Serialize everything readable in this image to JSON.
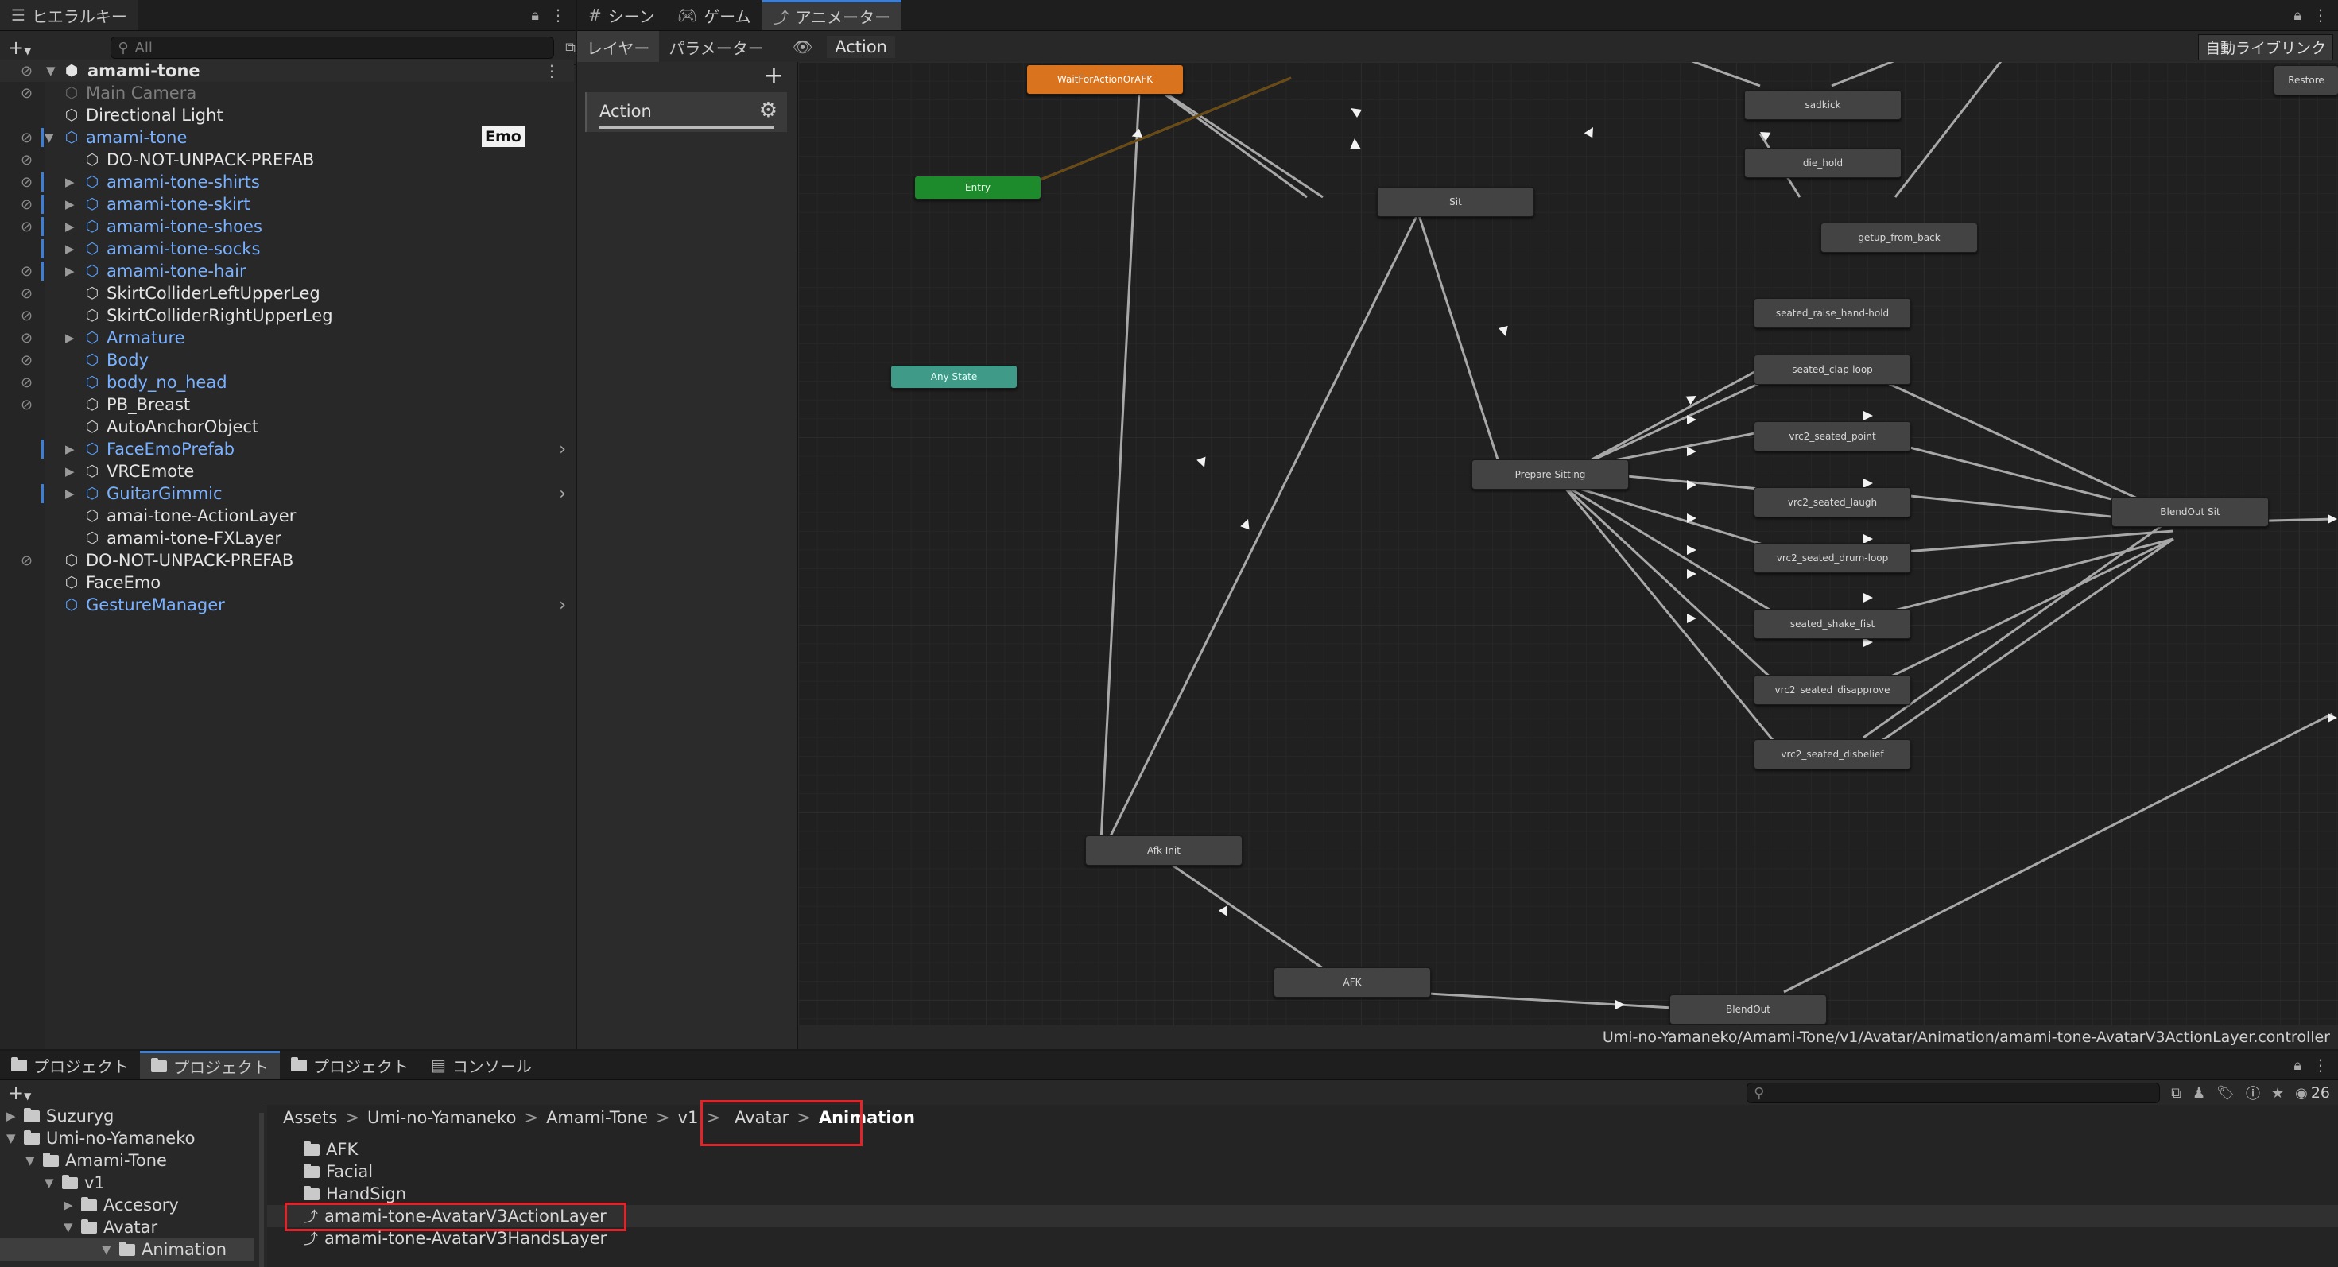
{
  "hierarchy": {
    "tab_label": "ヒエラルキー",
    "search_placeholder": "All",
    "scene_root": "amami-tone",
    "emo_badge": "Emo",
    "items": [
      {
        "label": "Main Camera"
      },
      {
        "label": "Directional Light"
      },
      {
        "label": "amami-tone"
      },
      {
        "label": "DO-NOT-UNPACK-PREFAB"
      },
      {
        "label": "amami-tone-shirts"
      },
      {
        "label": "amami-tone-skirt"
      },
      {
        "label": "amami-tone-shoes"
      },
      {
        "label": "amami-tone-socks"
      },
      {
        "label": "amami-tone-hair"
      },
      {
        "label": "SkirtColliderLeftUpperLeg"
      },
      {
        "label": "SkirtColliderRightUpperLeg"
      },
      {
        "label": "Armature"
      },
      {
        "label": "Body"
      },
      {
        "label": "body_no_head"
      },
      {
        "label": "PB_Breast"
      },
      {
        "label": "AutoAnchorObject"
      },
      {
        "label": "FaceEmoPrefab"
      },
      {
        "label": "VRCEmote"
      },
      {
        "label": "GuitarGimmic"
      },
      {
        "label": "amai-tone-ActionLayer"
      },
      {
        "label": "amami-tone-FXLayer"
      },
      {
        "label": "DO-NOT-UNPACK-PREFAB"
      },
      {
        "label": "FaceEmo"
      },
      {
        "label": "GestureManager"
      }
    ]
  },
  "animator": {
    "tabs": [
      {
        "label": "シーン"
      },
      {
        "label": "ゲーム"
      },
      {
        "label": "アニメーター"
      }
    ],
    "subtabs": [
      {
        "label": "レイヤー"
      },
      {
        "label": "パラメーター"
      }
    ],
    "breadcrumb": "Action",
    "auto_live_link": "自動ライブリンク",
    "restore_label": "Restore",
    "layer_name": "Action",
    "controller_path": "Umi-no-Yamaneko/Amami-Tone/v1/Avatar/Animation/amami-tone-AvatarV3ActionLayer.controller",
    "states": {
      "wait": "WaitForActionOrAFK",
      "entry": "Entry",
      "any": "Any State",
      "sit": "Sit",
      "sadkick": "sadkick",
      "die_hold": "die_hold",
      "getup": "getup_from_back",
      "raise": "seated_raise_hand-hold",
      "clap": "seated_clap-loop",
      "point": "vrc2_seated_point",
      "laugh": "vrc2_seated_laugh",
      "drum": "vrc2_seated_drum-loop",
      "shake": "seated_shake_fist",
      "disapprove": "vrc2_seated_disapprove",
      "disbelief": "vrc2_seated_disbelief",
      "prepare": "Prepare Sitting",
      "blendout_sit": "BlendOut Sit",
      "afk_init": "Afk Init",
      "afk": "AFK",
      "blendout": "BlendOut"
    }
  },
  "project": {
    "tabs": [
      {
        "label": "プロジェクト"
      },
      {
        "label": "プロジェクト"
      },
      {
        "label": "プロジェクト"
      },
      {
        "label": "コンソール"
      }
    ],
    "hidden_count": "26",
    "tree": [
      {
        "label": "Suzuryg"
      },
      {
        "label": "Umi-no-Yamaneko"
      },
      {
        "label": "Amami-Tone"
      },
      {
        "label": "v1"
      },
      {
        "label": "Accesory"
      },
      {
        "label": "Avatar"
      },
      {
        "label": "Animation"
      }
    ],
    "breadcrumb": [
      "Assets",
      "Umi-no-Yamaneko",
      "Amami-Tone",
      "v1",
      "Avatar",
      "Animation"
    ],
    "files": [
      {
        "label": "AFK"
      },
      {
        "label": "Facial"
      },
      {
        "label": "HandSign"
      },
      {
        "label": "amami-tone-AvatarV3ActionLayer"
      },
      {
        "label": "amami-tone-AvatarV3HandsLayer"
      }
    ]
  },
  "colors": {
    "accent": "#3b7fd6",
    "highlight_box": "#e0242a",
    "wait_state": "#d9731d",
    "entry_state": "#1d8a2c",
    "any_state": "#3f9a88"
  }
}
